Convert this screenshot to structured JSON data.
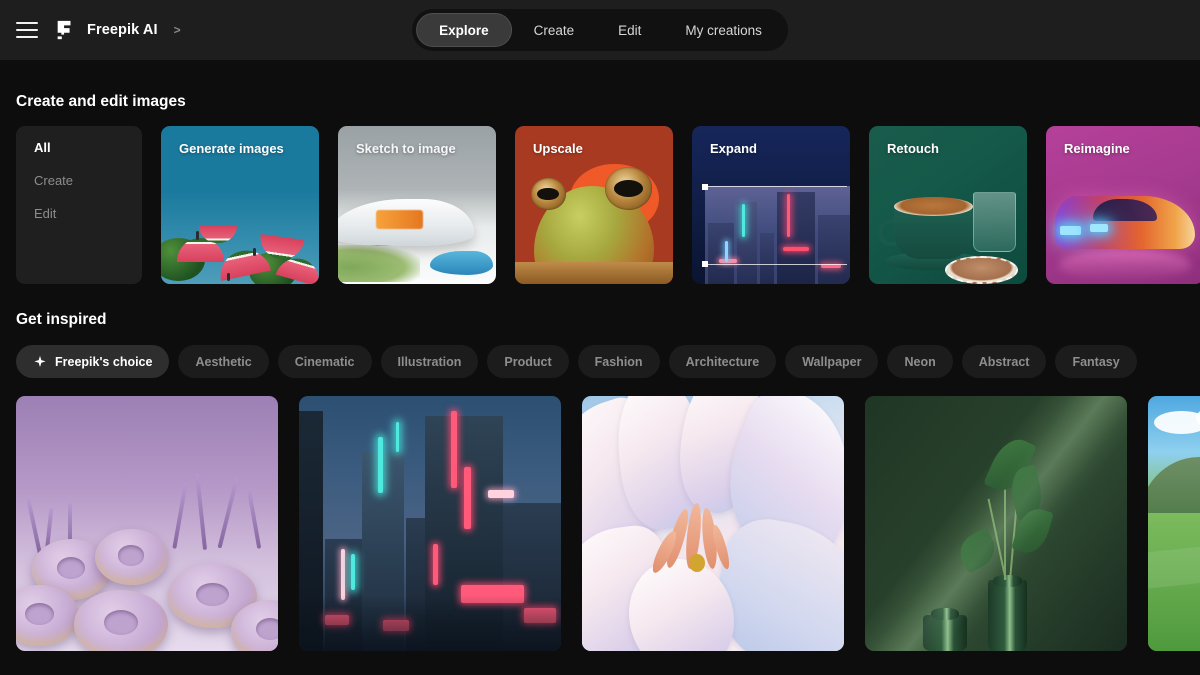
{
  "header": {
    "menu_icon": "hamburger-menu-icon",
    "logo_icon": "freepik-logo-icon",
    "brand": "Freepik AI",
    "breadcrumb_separator": ">",
    "tabs": [
      {
        "label": "Explore",
        "active": true
      },
      {
        "label": "Create",
        "active": false
      },
      {
        "label": "Edit",
        "active": false
      },
      {
        "label": "My creations",
        "active": false
      }
    ]
  },
  "sections": {
    "create_edit_title": "Create and edit images",
    "get_inspired_title": "Get inspired"
  },
  "filter_card": {
    "items": [
      {
        "label": "All",
        "active": true
      },
      {
        "label": "Create",
        "active": false
      },
      {
        "label": "Edit",
        "active": false
      }
    ]
  },
  "tool_cards": [
    {
      "label": "Generate images",
      "accent": "#1a7a9e",
      "art": "watermelon-pool"
    },
    {
      "label": "Sketch to image",
      "accent": "#aeb4b6",
      "art": "architecture-render"
    },
    {
      "label": "Upscale",
      "accent": "#a93a22",
      "art": "frog-portrait"
    },
    {
      "label": "Expand",
      "accent": "#16265a",
      "art": "cyberpunk-city-selection"
    },
    {
      "label": "Retouch",
      "accent": "#14594a",
      "art": "coffee-cup-cookie"
    },
    {
      "label": "Reimagine",
      "accent": "#b5409a",
      "art": "sports-car"
    }
  ],
  "chips": [
    {
      "label": "Freepik's choice",
      "active": true,
      "icon": "sparkle-icon"
    },
    {
      "label": "Aesthetic",
      "active": false
    },
    {
      "label": "Cinematic",
      "active": false
    },
    {
      "label": "Illustration",
      "active": false
    },
    {
      "label": "Product",
      "active": false
    },
    {
      "label": "Fashion",
      "active": false
    },
    {
      "label": "Architecture",
      "active": false
    },
    {
      "label": "Wallpaper",
      "active": false
    },
    {
      "label": "Neon",
      "active": false
    },
    {
      "label": "Abstract",
      "active": false
    },
    {
      "label": "Fantasy",
      "active": false
    }
  ],
  "gallery": [
    {
      "art": "lavender-donuts"
    },
    {
      "art": "cyberpunk-neon-street"
    },
    {
      "art": "pastel-flower-macro"
    },
    {
      "art": "green-plant-vase"
    },
    {
      "art": "green-hills-landscape"
    }
  ],
  "colors": {
    "page_bg": "#0d0d0d",
    "header_bg": "#1e1e1e",
    "navpill_bg": "#111111",
    "active_tab_bg": "#3a3a3a",
    "card_panel_bg": "#1f1f1f",
    "chip_bg": "#1c1c1c",
    "chip_active_bg": "#2e2e2e",
    "text_primary": "#ffffff",
    "text_muted": "#8e8e8e"
  }
}
